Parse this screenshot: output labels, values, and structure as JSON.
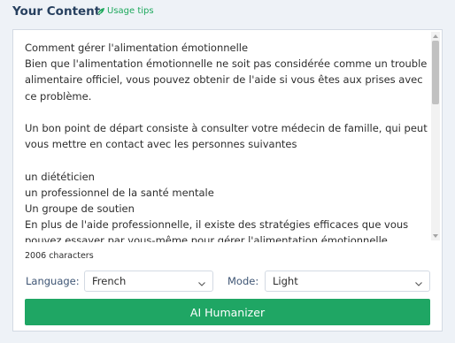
{
  "header": {
    "title": "Your Content",
    "usage_tips_label": "Usage tips",
    "usage_tips_icon": "leaf-icon"
  },
  "editor": {
    "text": "Comment gérer l'alimentation émotionnelle\nBien que l'alimentation émotionnelle ne soit pas considérée comme un trouble alimentaire officiel, vous pouvez obtenir de l'aide si vous êtes aux prises avec ce problème.\n\nUn bon point de départ consiste à consulter votre médecin de famille, qui peut vous mettre en contact avec les personnes suivantes\n\nun diététicien\nun professionnel de la santé mentale\nUn groupe de soutien\nEn plus de l'aide professionnelle, il existe des stratégies efficaces que vous pouvez essayer par vous-même pour gérer l'alimentation émotionnelle.",
    "char_count": "2006 characters"
  },
  "controls": {
    "language_label": "Language:",
    "language_value": "French",
    "mode_label": "Mode:",
    "mode_value": "Light",
    "submit_label": "AI Humanizer"
  },
  "colors": {
    "accent": "#1fa664",
    "title": "#27405f",
    "label": "#3e5574"
  }
}
